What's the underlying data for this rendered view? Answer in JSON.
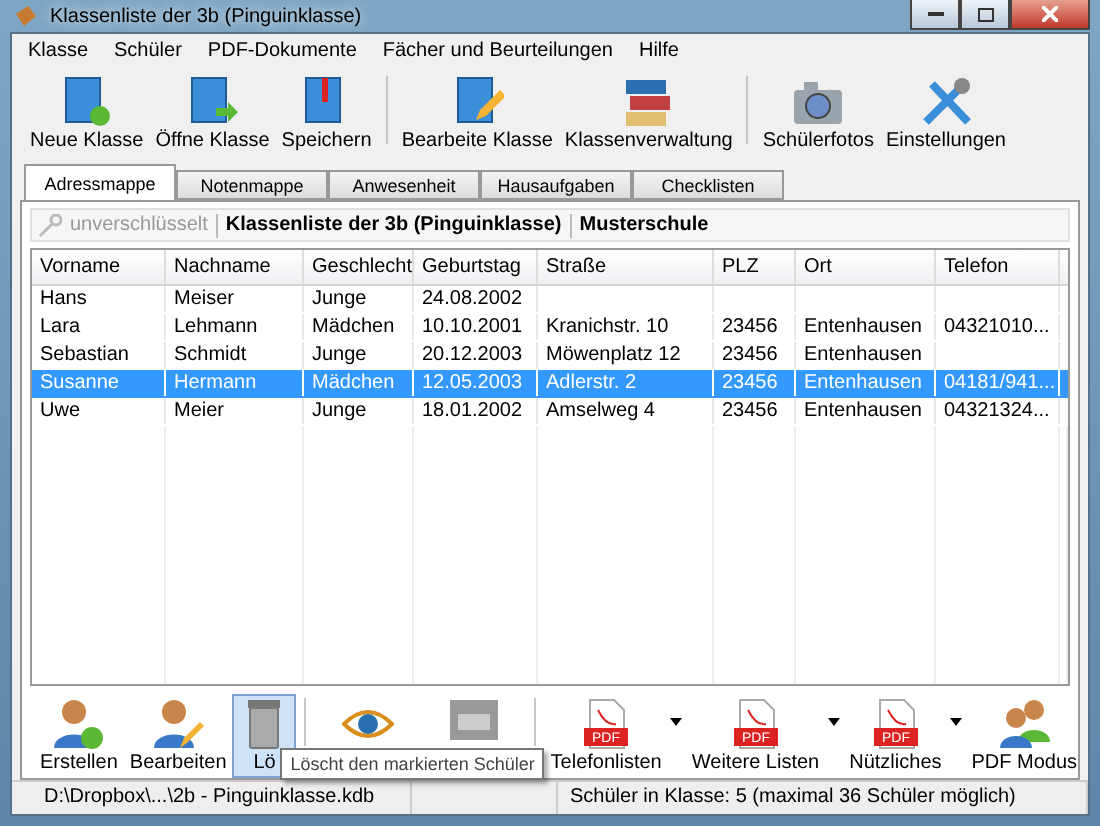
{
  "window": {
    "title": "Klassenliste der 3b (Pinguinklasse)"
  },
  "menu": [
    "Klasse",
    "Schüler",
    "PDF-Dokumente",
    "Fächer und Beurteilungen",
    "Hilfe"
  ],
  "toolbar": [
    {
      "label": "Neue Klasse",
      "kind": "new"
    },
    {
      "label": "Öffne Klasse",
      "kind": "open"
    },
    {
      "label": "Speichern",
      "kind": "save",
      "separator": true
    },
    {
      "label": "Bearbeite Klasse",
      "kind": "edit"
    },
    {
      "label": "Klassenverwaltung",
      "kind": "books",
      "separator": true
    },
    {
      "label": "Schülerfotos",
      "kind": "camera"
    },
    {
      "label": "Einstellungen",
      "kind": "tools"
    }
  ],
  "tabs": [
    {
      "label": "Adressmappe",
      "selected": true
    },
    {
      "label": "Notenmappe",
      "selected": false
    },
    {
      "label": "Anwesenheit",
      "selected": false
    },
    {
      "label": "Hausaufgaben",
      "selected": false
    },
    {
      "label": "Checklisten",
      "selected": false
    }
  ],
  "info_bar": {
    "encryption": "unverschlüsselt",
    "class_title": "Klassenliste der 3b (Pinguinklasse)",
    "school": "Musterschule"
  },
  "table": {
    "columns": [
      "Vorname",
      "Nachname",
      "Geschlecht",
      "Geburtstag",
      "Straße",
      "PLZ",
      "Ort",
      "Telefon"
    ],
    "rows": [
      {
        "cells": [
          "Hans",
          "Meiser",
          "Junge",
          "24.08.2002",
          "",
          "",
          "",
          ""
        ],
        "selected": false
      },
      {
        "cells": [
          "Lara",
          "Lehmann",
          "Mädchen",
          "10.10.2001",
          "Kranichstr. 10",
          "23456",
          "Entenhausen",
          "04321010..."
        ],
        "selected": false
      },
      {
        "cells": [
          "Sebastian",
          "Schmidt",
          "Junge",
          "20.12.2003",
          "Möwenplatz 12",
          "23456",
          "Entenhausen",
          ""
        ],
        "selected": false
      },
      {
        "cells": [
          "Susanne",
          "Hermann",
          "Mädchen",
          "12.05.2003",
          "Adlerstr. 2",
          "23456",
          "Entenhausen",
          "04181/941..."
        ],
        "selected": true
      },
      {
        "cells": [
          "Uwe",
          "Meier",
          "Junge",
          "18.01.2002",
          "Amselweg 4",
          "23456",
          "Entenhausen",
          "04321324..."
        ],
        "selected": false
      }
    ]
  },
  "bottom_toolbar": [
    {
      "label": "Erstellen",
      "kind": "add-person"
    },
    {
      "label": "Bearbeiten",
      "kind": "edit-person"
    },
    {
      "label": "Lö",
      "kind": "trash",
      "hovered": true,
      "separator": true
    },
    {
      "kind": "eye"
    },
    {
      "kind": "drawer",
      "separator": true
    },
    {
      "label": "Telefonlisten",
      "kind": "pdf",
      "badge": "PDF",
      "dropdown": true
    },
    {
      "label": "Weitere Listen",
      "kind": "pdf",
      "badge": "PDF",
      "dropdown": true
    },
    {
      "label": "Nützliches",
      "kind": "pdf",
      "badge": "PDF",
      "dropdown": true
    },
    {
      "label": "PDF Modus",
      "kind": "people"
    }
  ],
  "tooltip": "Löscht den markierten Schüler",
  "status_bar": [
    "D:\\Dropbox\\...\\2b - Pinguinklasse.kdb",
    "Schüler in Klasse: 5 (maximal 36 Schüler möglich)"
  ]
}
